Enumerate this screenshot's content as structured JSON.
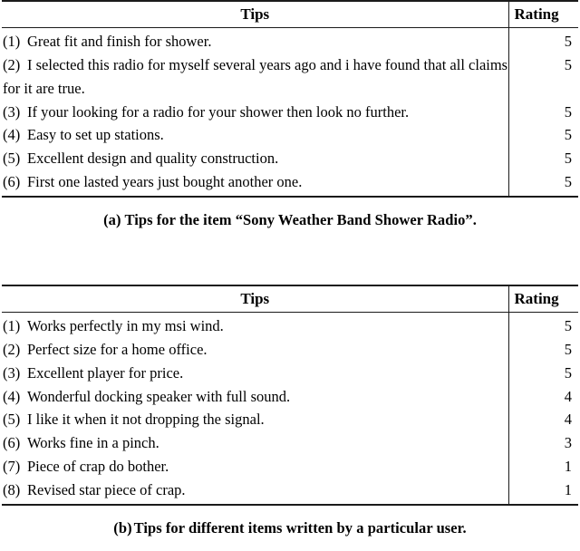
{
  "figures": [
    {
      "id": "figure-a",
      "caption_label": "(a)",
      "caption_text": "Tips for the item “Sony Weather Band Shower Radio”.",
      "table": {
        "headers": {
          "tips": "Tips",
          "rating": "Rating"
        },
        "rows": [
          {
            "index": "(1)",
            "tip": "Great fit and finish for shower.",
            "rating": "5"
          },
          {
            "index": "(2)",
            "tip": "I selected this radio for myself several years ago and i have found that all claims for it are true.",
            "rating": "5"
          },
          {
            "index": "(3)",
            "tip": "If your looking for a radio for your shower then look no further.",
            "rating": "5"
          },
          {
            "index": "(4)",
            "tip": "Easy to set up stations.",
            "rating": "5"
          },
          {
            "index": "(5)",
            "tip": "Excellent design and quality construction.",
            "rating": "5"
          },
          {
            "index": "(6)",
            "tip": "First one lasted years just bought another one.",
            "rating": "5"
          }
        ]
      }
    },
    {
      "id": "figure-b",
      "caption_label": "(b)",
      "caption_text": "Tips for different items written by a particular user.",
      "table": {
        "headers": {
          "tips": "Tips",
          "rating": "Rating"
        },
        "rows": [
          {
            "index": "(1)",
            "tip": "Works perfectly in my msi wind.",
            "rating": "5"
          },
          {
            "index": "(2)",
            "tip": "Perfect size for a home office.",
            "rating": "5"
          },
          {
            "index": "(3)",
            "tip": "Excellent player for price.",
            "rating": "5"
          },
          {
            "index": "(4)",
            "tip": "Wonderful docking speaker with full sound.",
            "rating": "4"
          },
          {
            "index": "(5)",
            "tip": "I like it when it not dropping the signal.",
            "rating": "4"
          },
          {
            "index": "(6)",
            "tip": "Works fine in a pinch.",
            "rating": "3"
          },
          {
            "index": "(7)",
            "tip": "Piece of crap do bother.",
            "rating": "1"
          },
          {
            "index": "(8)",
            "tip": "Revised star piece of crap.",
            "rating": "1"
          }
        ]
      }
    }
  ],
  "colors": {
    "rule": "#1a1a1a",
    "text": "#000000",
    "background": "#ffffff"
  }
}
